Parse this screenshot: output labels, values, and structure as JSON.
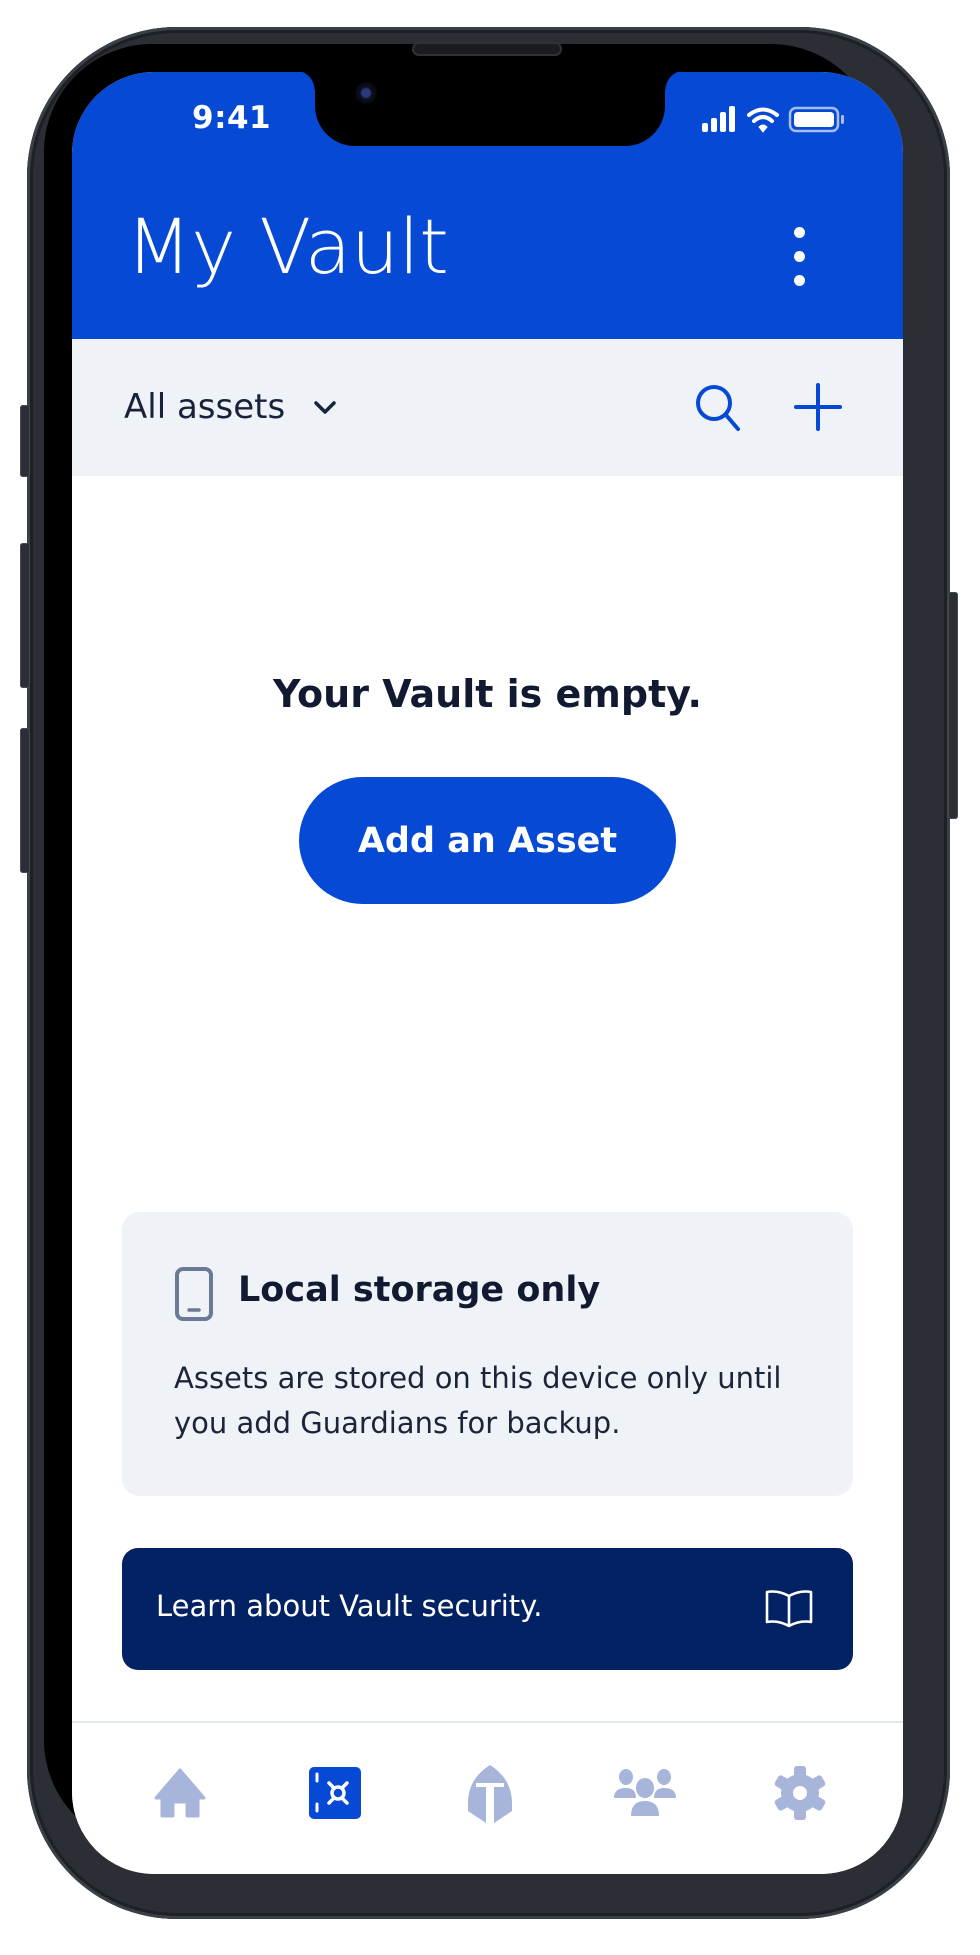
{
  "status_bar": {
    "time": "9:41",
    "icons": [
      "cellular-signal-icon",
      "wifi-icon",
      "battery-icon"
    ]
  },
  "header": {
    "title": "My Vault",
    "menu_icon": "more-vertical-icon"
  },
  "filter_bar": {
    "selected_filter": "All assets",
    "dropdown_icon": "chevron-down-icon",
    "actions": [
      "search-icon",
      "plus-icon"
    ]
  },
  "empty_state": {
    "message": "Your Vault is empty.",
    "button_label": "Add an Asset"
  },
  "info_card": {
    "icon": "smartphone-icon",
    "title": "Local storage only",
    "body": "Assets are stored on this device only until you add Guardians for backup."
  },
  "learn_banner": {
    "text": "Learn about Vault security.",
    "icon": "book-icon"
  },
  "tab_bar": {
    "tabs": [
      {
        "id": "home",
        "icon": "home-icon",
        "active": false
      },
      {
        "id": "vault",
        "icon": "vault-icon",
        "active": true
      },
      {
        "id": "guardians",
        "icon": "helmet-icon",
        "active": false
      },
      {
        "id": "people",
        "icon": "people-icon",
        "active": false
      },
      {
        "id": "settings",
        "icon": "gear-icon",
        "active": false
      }
    ]
  },
  "colors": {
    "primary": "#0649d4",
    "navy": "#032263",
    "surface": "#eff3f8",
    "text": "#111a30",
    "inactive_icon": "#a6b5d9",
    "muted_icon": "#6b7a94"
  }
}
